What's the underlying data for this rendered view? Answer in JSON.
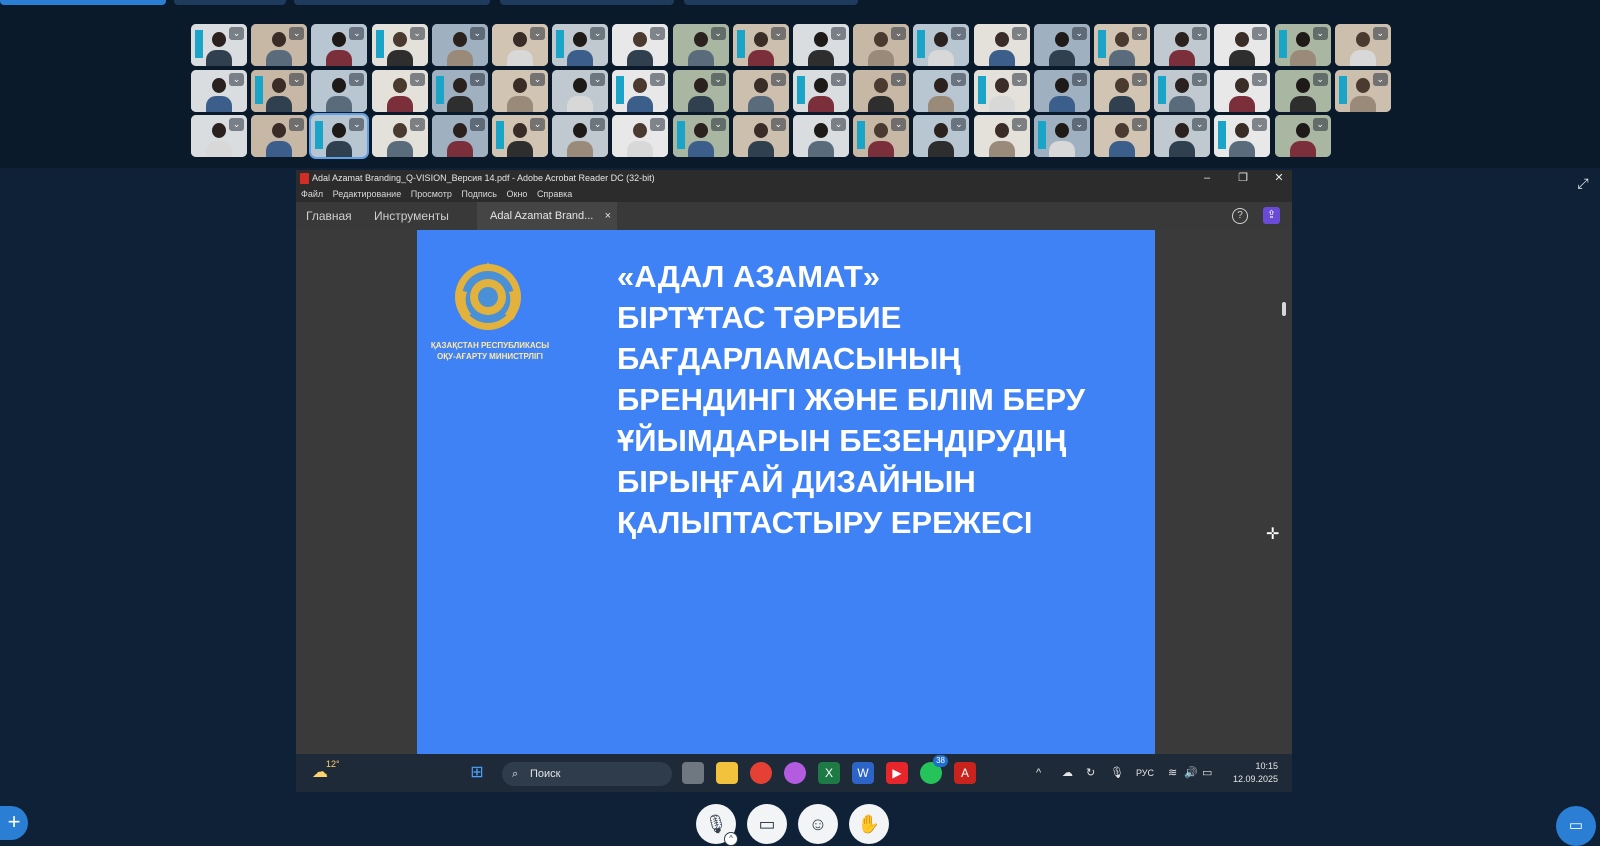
{
  "app": {
    "window_title": "Adal Azamat Branding_Q-VISION_Версия 14.pdf - Adobe Acrobat Reader DC (32-bit)",
    "menu": [
      "Файл",
      "Редактирование",
      "Просмотр",
      "Подпись",
      "Окно",
      "Справка"
    ],
    "tabs": {
      "home": "Главная",
      "tools": "Инструменты",
      "document": "Adal Azamat Brand..."
    }
  },
  "slide": {
    "title_lines": [
      "«АДАЛ АЗАМАТ»",
      "БІРТҰТАС ТӘРБИЕ",
      "БАҒДАРЛАМАСЫНЫҢ",
      "БРЕНДИНГІ ЖӘНЕ БІЛІМ БЕРУ",
      "ҰЙЫМДАРЫН БЕЗЕНДІРУДІҢ",
      "БІРЫҢҒАЙ ДИЗАЙНЫН",
      "ҚАЛЫПТАСТЫРУ ЕРЕЖЕСІ"
    ],
    "ministry_lines": [
      "ҚАЗАҚСТАН РЕСПУБЛИКАСЫ",
      "ОҚУ-АҒАРТУ МИНИСТРЛІГІ"
    ],
    "background_color": "#3f82f5"
  },
  "taskbar": {
    "weather": "12°",
    "search_placeholder": "Поиск",
    "whatsapp_badge": "38",
    "language": "РУС",
    "time": "10:15",
    "date": "12.09.2025"
  },
  "participants": {
    "row1": 20,
    "row2": 20,
    "row3": 19
  },
  "colors": {
    "accent": "#2a7fd4",
    "taskbar": "#1f2a38"
  }
}
